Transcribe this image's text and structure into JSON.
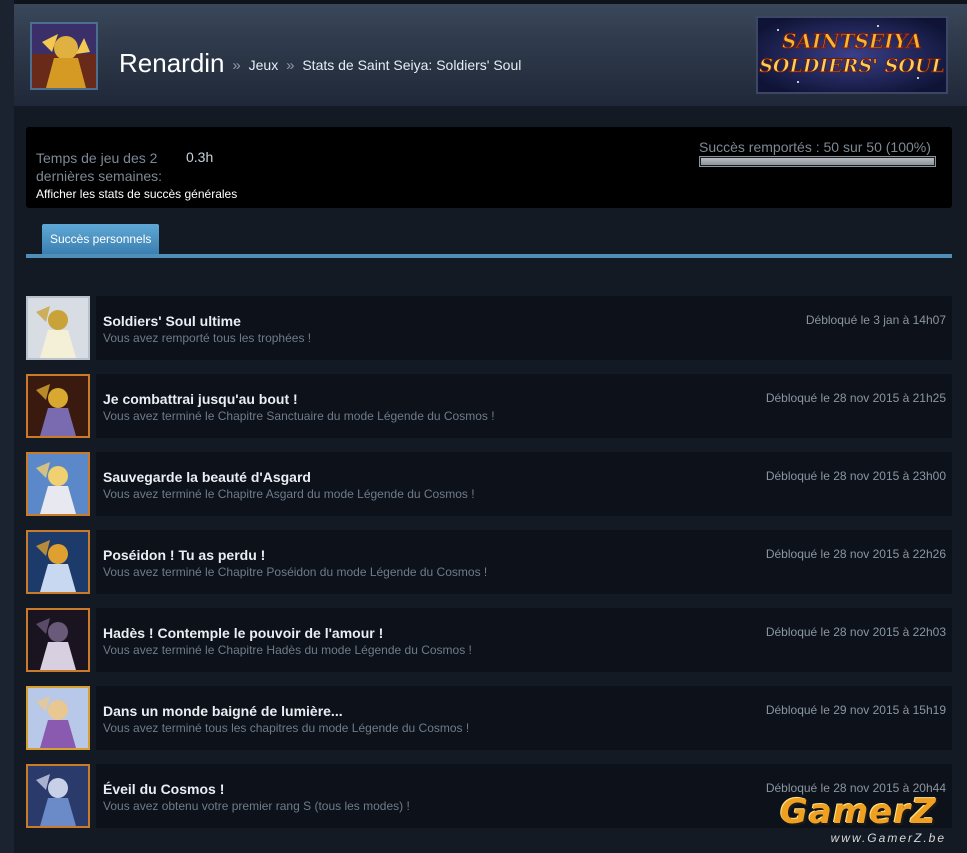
{
  "header": {
    "username": "Renardin",
    "separator": "»",
    "crumb_games": "Jeux",
    "crumb_stats": "Stats de Saint Seiya: Soldiers' Soul",
    "logo_text": "SAINTSEIYA SOLDIERS' SOUL"
  },
  "stats": {
    "playtime_label": "Temps de jeu des 2 dernières semaines:",
    "playtime_value": "0.3h",
    "general_link": "Afficher les stats de succès générales",
    "progress_text": "Succès remportés : 50 sur 50 (100%)",
    "progress_fraction": 1.0
  },
  "tabs": {
    "personal": "Succès personnels"
  },
  "achievements": [
    {
      "title": "Soldiers' Soul ultime",
      "desc": "Vous avez remporté tous les trophées !",
      "date": "Débloqué le 3 jan à 14h07",
      "tier": "silver"
    },
    {
      "title": "Je combattrai jusqu'au bout !",
      "desc": "Vous avez terminé le Chapitre Sanctuaire du mode Légende du Cosmos !",
      "date": "Débloqué le 28 nov 2015 à 21h25",
      "tier": "bronze"
    },
    {
      "title": "Sauvegarde la beauté d'Asgard",
      "desc": "Vous avez terminé le Chapitre Asgard du mode Légende du Cosmos !",
      "date": "Débloqué le 28 nov 2015 à 23h00",
      "tier": "bronze"
    },
    {
      "title": "Poséidon ! Tu as perdu !",
      "desc": "Vous avez terminé le Chapitre Poséidon du mode Légende du Cosmos !",
      "date": "Débloqué le 28 nov 2015 à 22h26",
      "tier": "bronze"
    },
    {
      "title": "Hadès ! Contemple le pouvoir de l'amour !",
      "desc": "Vous avez terminé le Chapitre Hadès du mode Légende du Cosmos !",
      "date": "Débloqué le 28 nov 2015 à 22h03",
      "tier": "bronze"
    },
    {
      "title": "Dans un monde baigné de lumière...",
      "desc": "Vous avez terminé tous les chapitres du mode Légende du Cosmos !",
      "date": "Débloqué le 29 nov 2015 à 15h19",
      "tier": "gold"
    },
    {
      "title": "Éveil du Cosmos !",
      "desc": "Vous avez obtenu votre premier rang S (tous les modes) !",
      "date": "Débloqué le 28 nov 2015 à 20h44",
      "tier": "bronze"
    }
  ],
  "watermark": {
    "brand": "GamerZ",
    "url": "www.GamerZ.be"
  }
}
